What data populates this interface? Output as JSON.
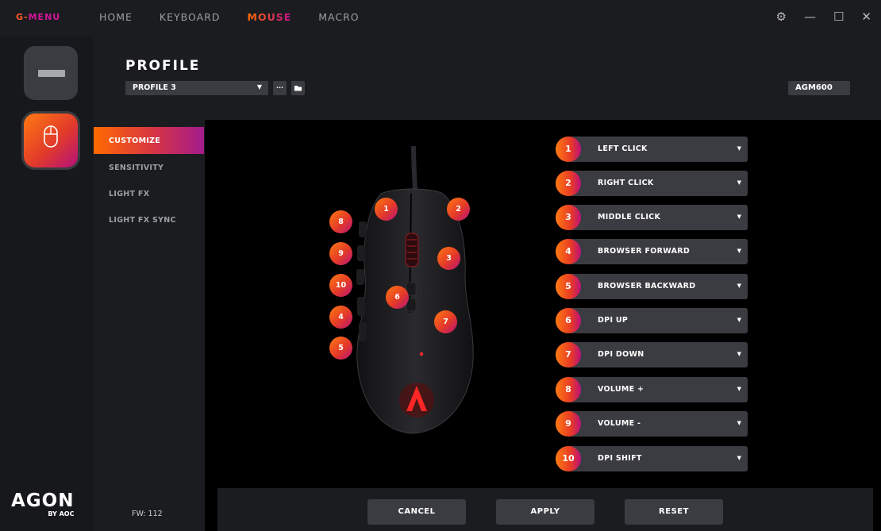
{
  "app": {
    "brand_g": "G-",
    "brand_menu": "MENU",
    "nav": [
      "HOME",
      "KEYBOARD",
      "MOUSE",
      "MACRO"
    ],
    "active_nav": "MOUSE",
    "window_controls": [
      "gear-icon",
      "minimize-icon",
      "maximize-icon",
      "close-icon"
    ]
  },
  "rail": {
    "devices": [
      "keyboard-icon",
      "mouse-icon"
    ],
    "logo_main": "AGON",
    "logo_sub": "BY AOC"
  },
  "header": {
    "title": "PROFILE",
    "profile_select": "PROFILE 3",
    "more_button": "···",
    "model": "AGM600"
  },
  "sidemenu": {
    "items": [
      "CUSTOMIZE",
      "SENSITIVITY",
      "LIGHT FX",
      "LIGHT FX SYNC"
    ],
    "active": "CUSTOMIZE",
    "firmware": "FW: 112"
  },
  "mouse_markers": [
    "1",
    "2",
    "3",
    "4",
    "5",
    "6",
    "7",
    "8",
    "9",
    "10"
  ],
  "bindings": [
    {
      "num": "1",
      "label": "LEFT CLICK"
    },
    {
      "num": "2",
      "label": "RIGHT CLICK"
    },
    {
      "num": "3",
      "label": "MIDDLE CLICK"
    },
    {
      "num": "4",
      "label": "BROWSER FORWARD"
    },
    {
      "num": "5",
      "label": "BROWSER BACKWARD"
    },
    {
      "num": "6",
      "label": "DPI UP"
    },
    {
      "num": "7",
      "label": "DPI DOWN"
    },
    {
      "num": "8",
      "label": "VOLUME +"
    },
    {
      "num": "9",
      "label": "VOLUME -"
    },
    {
      "num": "10",
      "label": "DPI SHIFT"
    }
  ],
  "footer": {
    "cancel": "CANCEL",
    "apply": "APPLY",
    "reset": "RESET"
  },
  "colors": {
    "accent_orange": "#ff6a00",
    "accent_magenta": "#c2128c",
    "panel": "#1b1c20",
    "control": "#3b3c42"
  }
}
